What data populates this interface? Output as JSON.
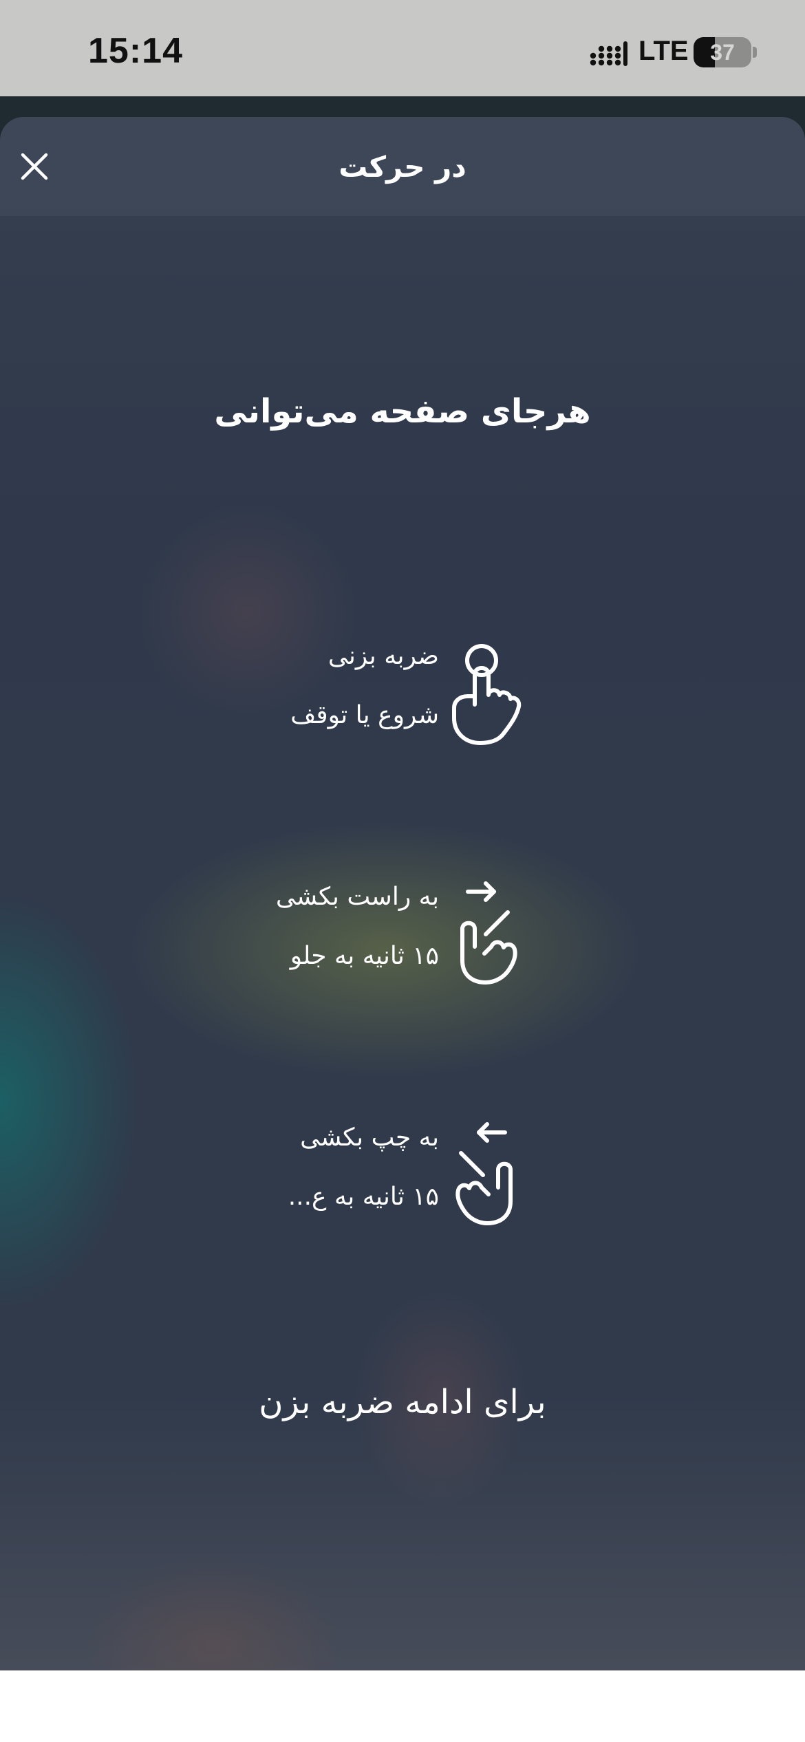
{
  "status_bar": {
    "time": "15:14",
    "network": "LTE",
    "battery_percent": "37",
    "battery_level": 0.37
  },
  "sheet": {
    "title": "در حرکت",
    "close_icon": "close-icon"
  },
  "content": {
    "intro_title": "هرجای صفحه می‌توانی",
    "gestures": [
      {
        "title": "ضربه بزنی",
        "subtitle": "شروع یا توقف",
        "icon": "tap-gesture-icon"
      },
      {
        "title": "به راست بکشی",
        "subtitle": "۱۵ ثانیه به جلو",
        "icon": "swipe-right-gesture-icon"
      },
      {
        "title": "به چپ بکشی",
        "subtitle": "۱۵ ثانیه به ع...",
        "icon": "swipe-left-gesture-icon"
      }
    ],
    "continue_text": "برای ادامه ضربه بزن"
  },
  "colors": {
    "status_bar": "#c8c9c6",
    "sheet_header": "#485262",
    "sheet_background": "#303a4b",
    "text_primary": "#ffffff"
  }
}
